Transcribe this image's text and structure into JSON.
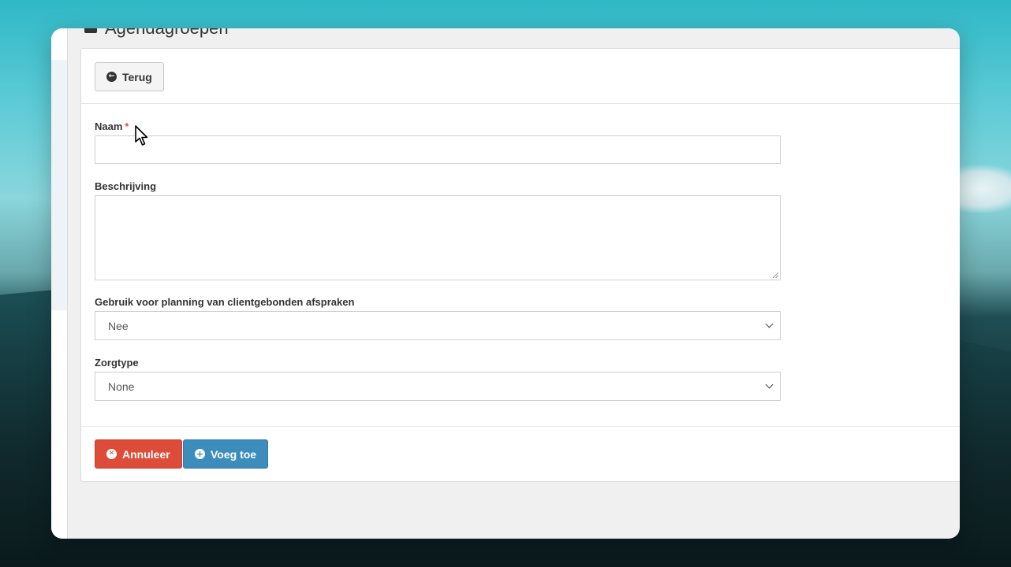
{
  "header": {
    "title": "Agendagroepen",
    "icon": "briefcase-icon"
  },
  "toolbar": {
    "back_label": "Terug",
    "back_icon": "arrow-circle-left-icon"
  },
  "form": {
    "name_label": "Naam",
    "name_required_marker": "*",
    "name_value": "",
    "description_label": "Beschrijving",
    "description_value": "",
    "planning_label": "Gebruik voor planning van clientgebonden afspraken",
    "planning_value": "Nee",
    "caretype_label": "Zorgtype",
    "caretype_value": "None"
  },
  "footer": {
    "cancel_label": "Annuleer",
    "cancel_icon": "times-circle-icon",
    "add_label": "Voeg toe",
    "add_icon": "plus-circle-icon"
  },
  "colors": {
    "cancel": "#dd4b39",
    "add": "#3c8dbc",
    "required": "#dd4b39"
  }
}
